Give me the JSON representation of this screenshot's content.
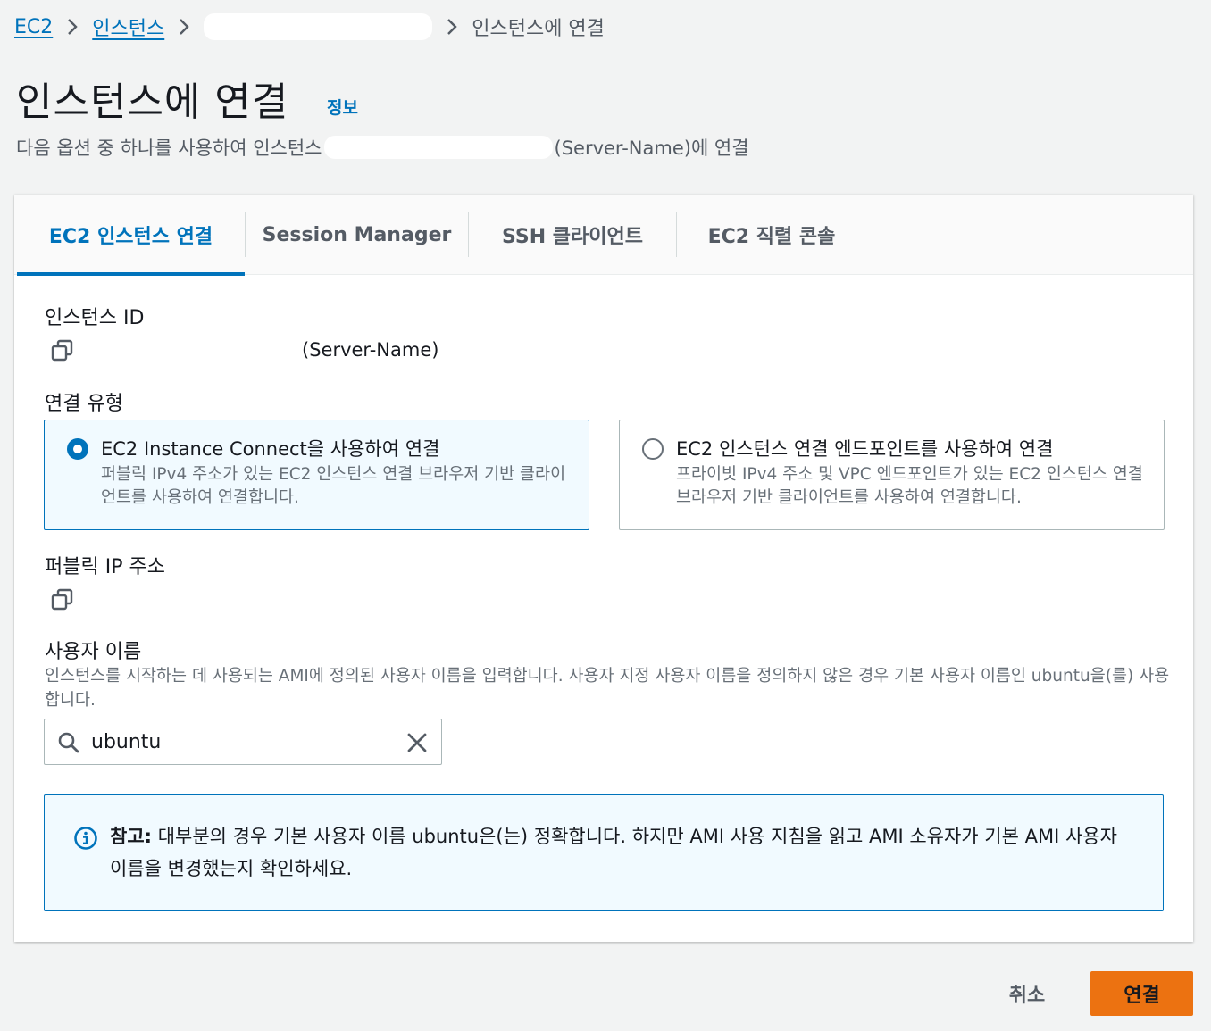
{
  "breadcrumb": {
    "items": [
      "EC2",
      "인스턴스",
      "인스턴스에 연결"
    ]
  },
  "header": {
    "title": "인스턴스에 연결",
    "info": "정보",
    "subtitle_prefix": "다음 옵션 중 하나를 사용하여 인스턴스",
    "subtitle_suffix": "(Server-Name)에 연결"
  },
  "tabs": [
    {
      "label": "EC2 인스턴스 연결",
      "active": true
    },
    {
      "label": "Session Manager",
      "active": false
    },
    {
      "label": "SSH 클라이언트",
      "active": false
    },
    {
      "label": "EC2 직렬 콘솔",
      "active": false
    }
  ],
  "instance": {
    "label": "인스턴스 ID",
    "value": "(Server-Name)"
  },
  "connection_type": {
    "label": "연결 유형",
    "options": [
      {
        "title": "EC2 Instance Connect을 사용하여 연결",
        "desc": "퍼블릭 IPv4 주소가 있는 EC2 인스턴스 연결 브라우저 기반 클라이언트를 사용하여 연결합니다.",
        "selected": true
      },
      {
        "title": "EC2 인스턴스 연결 엔드포인트를 사용하여 연결",
        "desc": "프라이빗 IPv4 주소 및 VPC 엔드포인트가 있는 EC2 인스턴스 연결 브라우저 기반 클라이언트를 사용하여 연결합니다.",
        "selected": false
      }
    ]
  },
  "public_ip": {
    "label": "퍼블릭 IP 주소"
  },
  "username": {
    "label": "사용자 이름",
    "hint": "인스턴스를 시작하는 데 사용되는 AMI에 정의된 사용자 이름을 입력합니다. 사용자 지정 사용자 이름을 정의하지 않은 경우 기본 사용자 이름인 ubuntu을(를) 사용합니다.",
    "value": "ubuntu"
  },
  "alert": {
    "bold": "참고:",
    "text": " 대부분의 경우 기본 사용자 이름 ubuntu은(는) 정확합니다. 하지만 AMI 사용 지침을 읽고 AMI 소유자가 기본 AMI 사용자 이름을 변경했는지 확인하세요."
  },
  "actions": {
    "cancel": "취소",
    "connect": "연결"
  },
  "colors": {
    "link": "#0073bb",
    "primary": "#ec7211",
    "selected_bg": "#f1faff"
  }
}
